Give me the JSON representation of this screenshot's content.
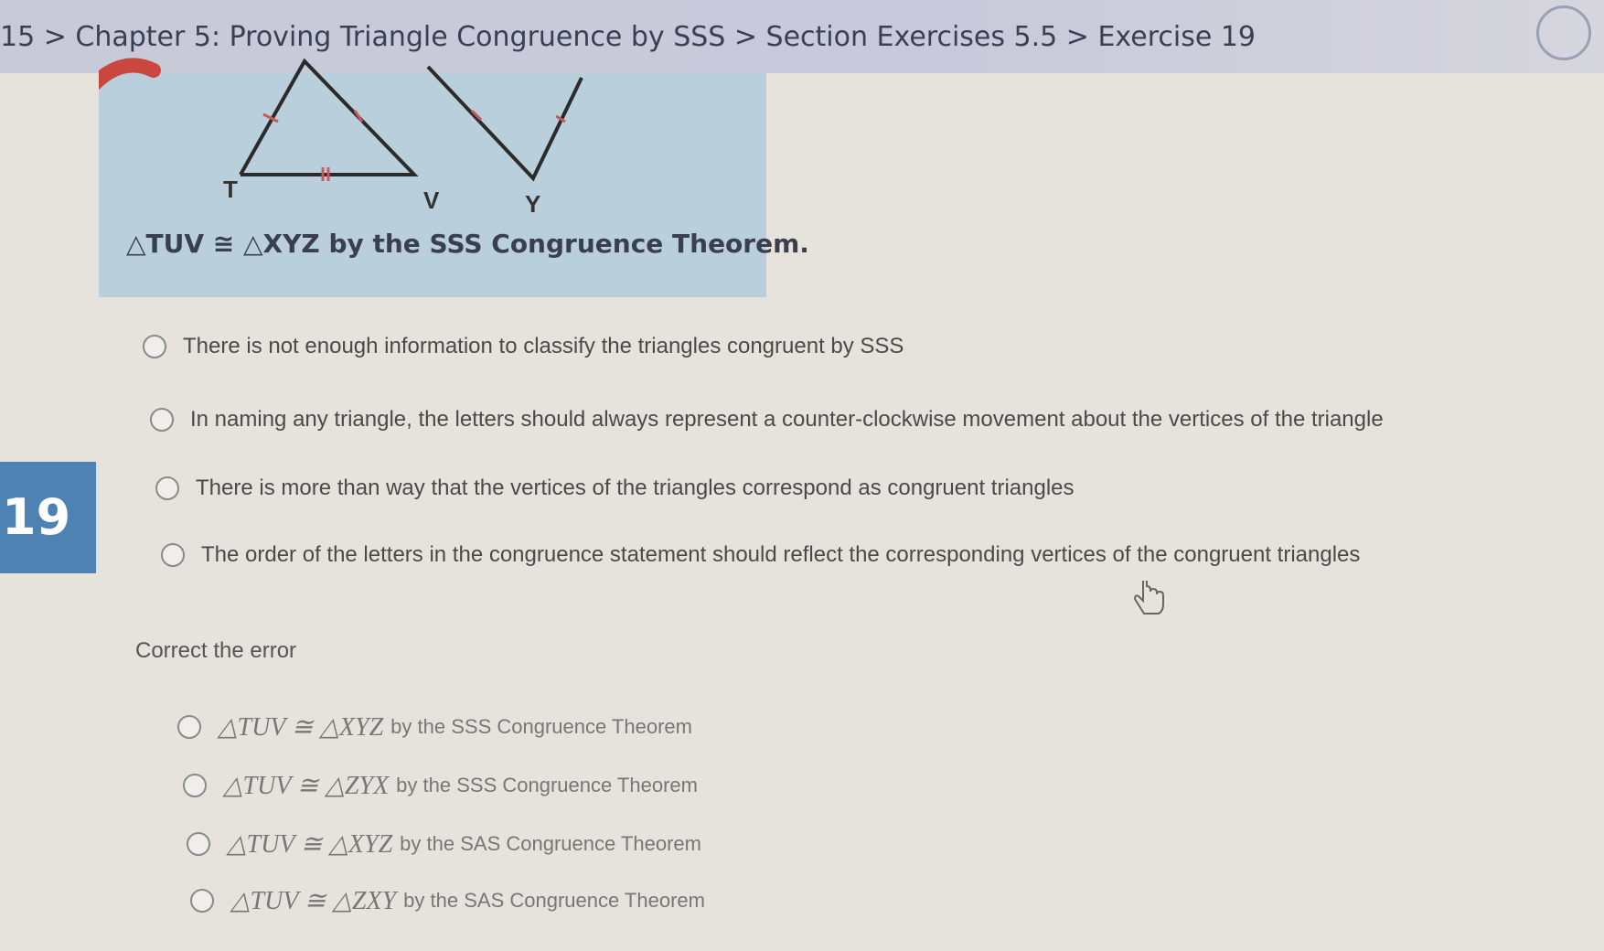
{
  "breadcrumb": {
    "text": "15 > Chapter 5: Proving Triangle Congruence by SSS > Section Exercises 5.5 > Exercise 19"
  },
  "figure": {
    "label_t": "T",
    "label_v": "V",
    "label_y": "Y",
    "statement": "△TUV ≅ △XYZ by the SSS Congruence Theorem."
  },
  "question": {
    "number": "19",
    "options": [
      "There is not enough information to classify the triangles congruent by SSS",
      "In naming any triangle, the letters should always represent a counter-clockwise movement about the vertices of the triangle",
      "There is more than way that the vertices of the triangles correspond as congruent triangles",
      "The order of the letters in the congruence statement should reflect the corresponding vertices of the congruent triangles"
    ]
  },
  "correction": {
    "label": "Correct the error",
    "options": [
      {
        "math": "△TUV ≅ △XYZ",
        "theorem": "by the SSS Congruence Theorem"
      },
      {
        "math": "△TUV ≅ △ZYX",
        "theorem": "by the SSS Congruence Theorem"
      },
      {
        "math": "△TUV ≅ △XYZ",
        "theorem": "by the SAS Congruence Theorem"
      },
      {
        "math": "△TUV ≅ △ZXY",
        "theorem": "by the SAS Congruence Theorem"
      }
    ]
  },
  "colors": {
    "panel": "#b9cfdc",
    "qnum_bg": "#4e82b2",
    "topbar": "#c9cad8"
  }
}
